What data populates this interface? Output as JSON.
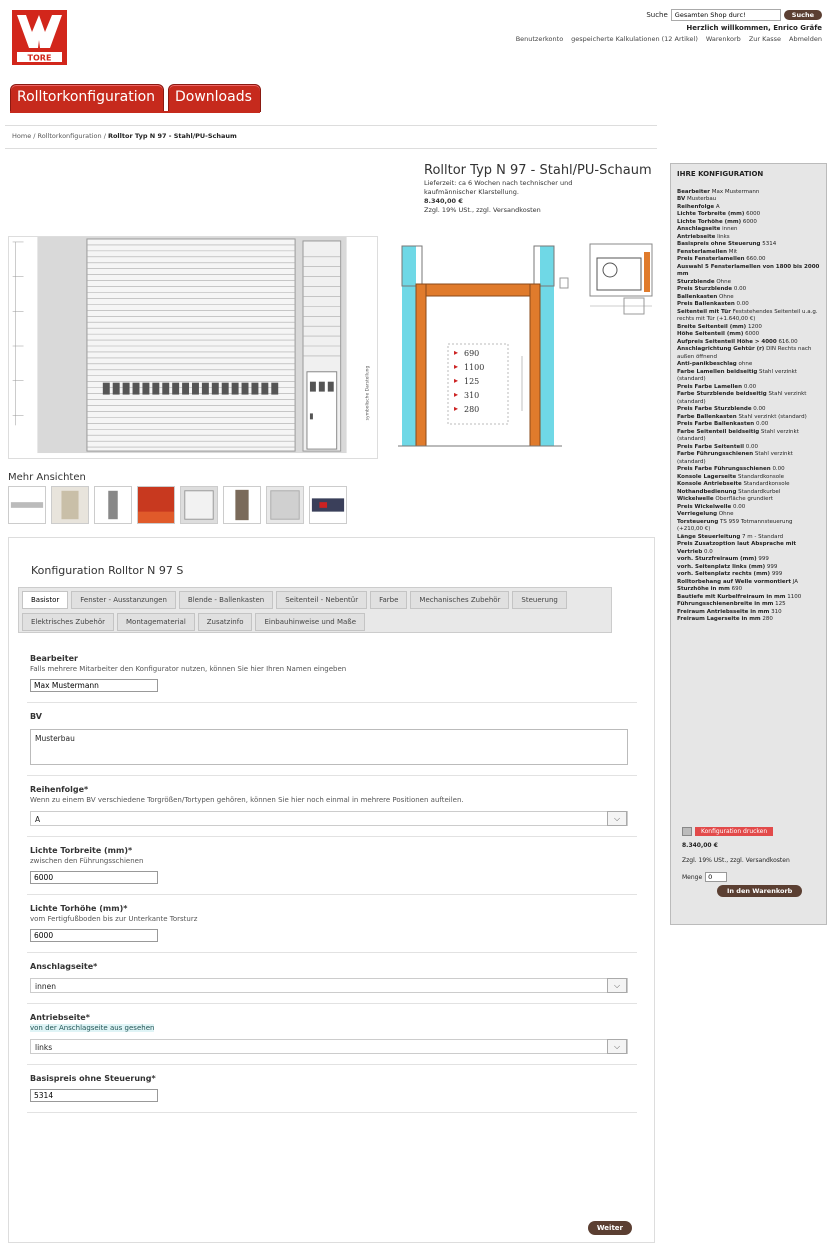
{
  "header": {
    "search_label": "Suche",
    "search_value": "Gesamten Shop durc!",
    "search_button": "Suche",
    "welcome": "Herzlich willkommen, Enrico Gräfe",
    "links": [
      "Benutzerkonto",
      "gespeicherte Kalkulationen (12 Artikel)",
      "Warenkorb",
      "Zur Kasse",
      "Abmelden"
    ],
    "logo_text": "TORE"
  },
  "nav": {
    "config": "Rolltorkonfiguration",
    "downloads": "Downloads"
  },
  "breadcrumb": {
    "home": "Home",
    "section": "Rolltorkonfiguration",
    "current": "Rolltor Typ N 97 - Stahl/PU-Schaum"
  },
  "product": {
    "title": "Rolltor Typ N 97 - Stahl/PU-Schaum",
    "delivery": "Lieferzeit: ca 6 Wochen nach technischer und kaufmännischer Klarstellung.",
    "price": "8.340,00 €",
    "tax": "Zzgl. 19% USt., zzgl. Versandkosten"
  },
  "drawing": {
    "side_label": "symbolische Darstellung",
    "dimensions": [
      "690",
      "1100",
      "125",
      "310",
      "280"
    ]
  },
  "more_views": "Mehr Ansichten",
  "config": {
    "title": "Konfiguration Rolltor N 97 S",
    "tabs_row1": [
      "Basistor",
      "Fenster - Ausstanzungen",
      "Blende - Ballenkasten",
      "Seitenteil - Nebentür",
      "Farbe",
      "Mechanisches Zubehör"
    ],
    "tabs_row2": [
      "Steuerung",
      "Elektrisches Zubehör",
      "Montagematerial",
      "Zusatzinfo",
      "Einbauhinweise und Maße"
    ],
    "fields": {
      "bearbeiter": {
        "label": "Bearbeiter",
        "help": "Falls mehrere Mitarbeiter den Konfigurator nutzen, können Sie hier Ihren Namen eingeben",
        "value": "Max Mustermann"
      },
      "bv": {
        "label": "BV",
        "value": "Musterbau"
      },
      "reihenfolge": {
        "label": "Reihenfolge*",
        "help": "Wenn zu einem BV verschiedene Torgrößen/Tortypen gehören, können Sie hier noch einmal in mehrere Positionen aufteilen.",
        "value": "A"
      },
      "breite": {
        "label": "Lichte Torbreite (mm)*",
        "help": "zwischen den Führungsschienen",
        "value": "6000"
      },
      "hoehe": {
        "label": "Lichte Torhöhe (mm)*",
        "help": "vom Fertigfußboden bis zur Unterkante Torsturz",
        "value": "6000"
      },
      "anschlag": {
        "label": "Anschlagseite*",
        "value": "innen"
      },
      "antrieb": {
        "label": "Antriebseite*",
        "help": "von der Anschlagseite aus gesehen",
        "value": "links"
      },
      "basispreis": {
        "label": "Basispreis ohne Steuerung*",
        "value": "5314"
      }
    },
    "next": "Weiter"
  },
  "sidebar": {
    "title": "IHRE KONFIGURATION",
    "rows": [
      [
        "Bearbeiter",
        "Max Mustermann"
      ],
      [
        "BV",
        "Musterbau"
      ],
      [
        "Reihenfolge",
        "A"
      ],
      [
        "Lichte Torbreite (mm)",
        "6000"
      ],
      [
        "Lichte Torhöhe (mm)",
        "6000"
      ],
      [
        "Anschlagseite",
        "innen"
      ],
      [
        "Antriebseite",
        "links"
      ],
      [
        "Basispreis ohne Steuerung",
        "5314"
      ],
      [
        "Fensterlamellen",
        "Mit"
      ],
      [
        "Preis Fensterlamellen",
        "660.00"
      ],
      [
        "Auswahl 5 Fensterlamellen von 1800 bis 2000 mm",
        ""
      ],
      [
        "Sturzblende",
        "Ohne"
      ],
      [
        "Preis Sturzblende",
        "0.00"
      ],
      [
        "Ballenkasten",
        "Ohne"
      ],
      [
        "Preis Ballenkasten",
        "0.00"
      ],
      [
        "Seitenteil mit Tür",
        "Feststehendes Seitenteil u.a.g. rechts mit Tür (+1.640,00 €)"
      ],
      [
        "Breite Seitenteil (mm)",
        "1200"
      ],
      [
        "Höhe Seitenteil (mm)",
        "6000"
      ],
      [
        "Aufpreis Seitenteil Höhe > 4000",
        "616.00"
      ],
      [
        "Anschlagrichtung Gehtür (r)",
        "DIN Rechts nach außen öffnend"
      ],
      [
        "Anti-panikbeschlag",
        "ohne"
      ],
      [
        "Farbe Lamellen beidseitig",
        "Stahl verzinkt (standard)"
      ],
      [
        "Preis Farbe Lamellen",
        "0.00"
      ],
      [
        "Farbe Sturzblende beidseitig",
        "Stahl verzinkt (standard)"
      ],
      [
        "Preis Farbe Sturzblende",
        "0.00"
      ],
      [
        "Farbe Ballenkasten",
        "Stahl verzinkt (standard)"
      ],
      [
        "Preis Farbe Ballenkasten",
        "0.00"
      ],
      [
        "Farbe Seitenteil beidseitig",
        "Stahl verzinkt (standard)"
      ],
      [
        "Preis Farbe Seitenteil",
        "0.00"
      ],
      [
        "Farbe Führungsschienen",
        "Stahl verzinkt (standard)"
      ],
      [
        "Preis Farbe Führungsschienen",
        "0.00"
      ],
      [
        "Konsole Lagerseite",
        "Standardkonsole"
      ],
      [
        "Konsole Antriebseite",
        "Standardkonsole"
      ],
      [
        "Nothandbedienung",
        "Standardkurbel"
      ],
      [
        "Wickelwelle",
        "Oberfläche grundiert"
      ],
      [
        "Preis Wickelwelle",
        "0.00"
      ],
      [
        "Verriegelung",
        "Ohne"
      ],
      [
        "Torsteuerung",
        "TS 959 Totmannsteuerung (+210,00 €)"
      ],
      [
        "Länge Steuerleitung",
        "7 m - Standard"
      ],
      [
        "Preis Zusatzoption laut Absprache mit Vertrieb",
        "0.0"
      ],
      [
        "vorh. Sturzfreiraum (mm)",
        "999"
      ],
      [
        "vorh. Seitenplatz links (mm)",
        "999"
      ],
      [
        "vorh. Seitenplatz rechts (mm)",
        "999"
      ],
      [
        "Rolltorbehang auf Welle vormontiert",
        "JA"
      ],
      [
        "Sturzhöhe in mm",
        "690"
      ],
      [
        "Bautiefe mit Kurbelfreiraum in mm",
        "1100"
      ],
      [
        "Führungsschienenbreite in mm",
        "125"
      ],
      [
        "Freiraum Antriebsseite in mm",
        "310"
      ],
      [
        "Freiraum Lagerseite in mm",
        "280"
      ]
    ],
    "print": "Konfiguration drucken",
    "price": "8.340,00 €",
    "tax": "Zzgl. 19% USt., zzgl. Versandkosten",
    "qty_label": "Menge",
    "qty_value": "0",
    "cart": "In den Warenkorb"
  },
  "colors": {
    "brand_red": "#c62a1d",
    "button_brown": "#5b3f32"
  }
}
